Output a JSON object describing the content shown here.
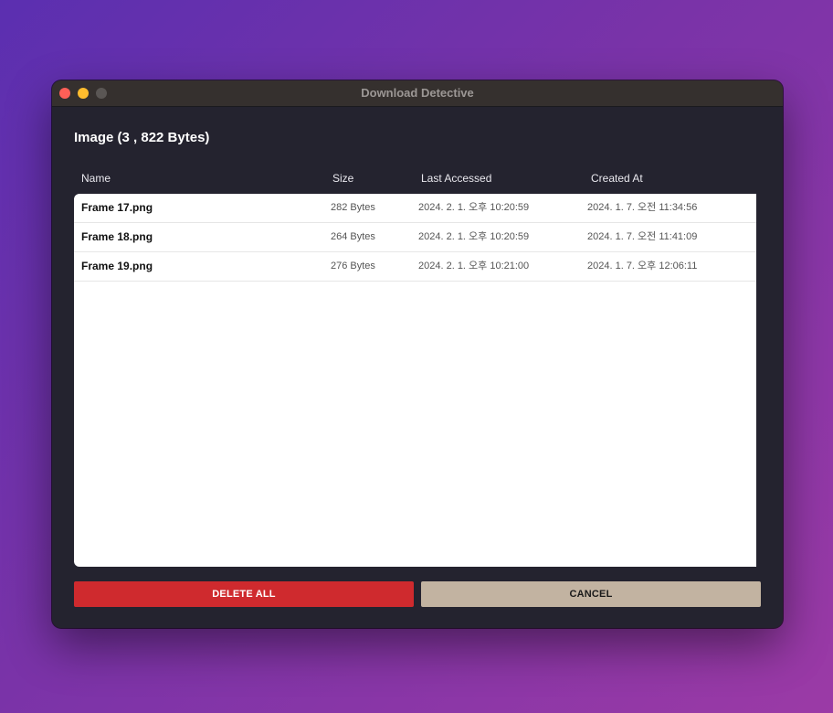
{
  "window": {
    "title": "Download Detective"
  },
  "heading": "Image (3 , 822 Bytes)",
  "table": {
    "columns": [
      "Name",
      "Size",
      "Last Accessed",
      "Created At"
    ],
    "rows": [
      {
        "name": "Frame 17.png",
        "size": "282 Bytes",
        "last_accessed": "2024. 2. 1. 오후 10:20:59",
        "created_at": "2024. 1. 7. 오전 11:34:56"
      },
      {
        "name": "Frame 18.png",
        "size": "264 Bytes",
        "last_accessed": "2024. 2. 1. 오후 10:20:59",
        "created_at": "2024. 1. 7. 오전 11:41:09"
      },
      {
        "name": "Frame 19.png",
        "size": "276 Bytes",
        "last_accessed": "2024. 2. 1. 오후 10:21:00",
        "created_at": "2024. 1. 7. 오후 12:06:11"
      }
    ]
  },
  "buttons": {
    "delete_all": "DELETE ALL",
    "cancel": "CANCEL"
  },
  "colors": {
    "delete": "#cf2a2e",
    "cancel": "#c2b3a1",
    "window_bg": "#24232f"
  }
}
